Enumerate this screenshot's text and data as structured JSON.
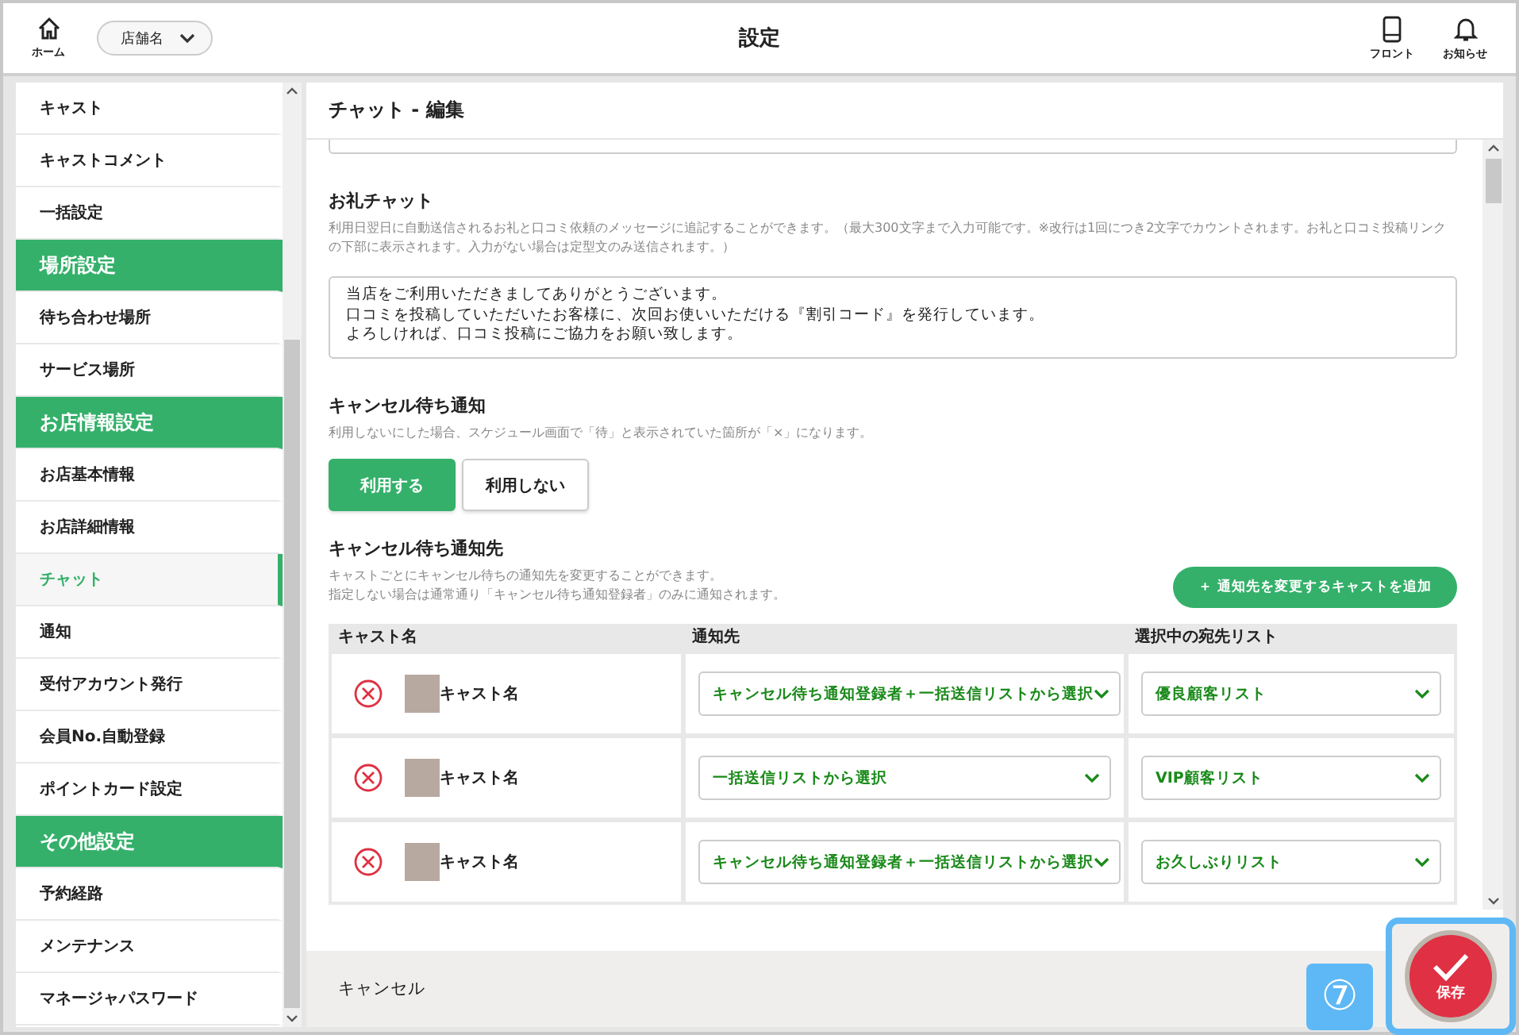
{
  "header": {
    "home_label": "ホーム",
    "store_select": "店舗名",
    "title": "設定",
    "actions": [
      {
        "kind": "phone",
        "label": "フロント"
      },
      {
        "kind": "bell",
        "label": "お知らせ"
      }
    ]
  },
  "sidebar": {
    "items": [
      {
        "kind": "item",
        "label": "キャスト",
        "selected": false
      },
      {
        "kind": "item",
        "label": "キャストコメント",
        "selected": false
      },
      {
        "kind": "item",
        "label": "一括設定",
        "selected": false
      },
      {
        "kind": "header",
        "label": "場所設定"
      },
      {
        "kind": "item",
        "label": "待ち合わせ場所",
        "selected": false
      },
      {
        "kind": "item",
        "label": "サービス場所",
        "selected": false
      },
      {
        "kind": "header",
        "label": "お店情報設定"
      },
      {
        "kind": "item",
        "label": "お店基本情報",
        "selected": false
      },
      {
        "kind": "item",
        "label": "お店詳細情報",
        "selected": false
      },
      {
        "kind": "item",
        "label": "チャット",
        "selected": true
      },
      {
        "kind": "item",
        "label": "通知",
        "selected": false
      },
      {
        "kind": "item",
        "label": "受付アカウント発行",
        "selected": false
      },
      {
        "kind": "item",
        "label": "会員No.自動登録",
        "selected": false
      },
      {
        "kind": "item",
        "label": "ポイントカード設定",
        "selected": false
      },
      {
        "kind": "header",
        "label": "その他設定"
      },
      {
        "kind": "item",
        "label": "予約経路",
        "selected": false
      },
      {
        "kind": "item",
        "label": "メンテナンス",
        "selected": false
      },
      {
        "kind": "item",
        "label": "マネージャパスワード",
        "selected": false
      }
    ]
  },
  "panel": {
    "title": "チャット - 編集",
    "thanks_chat": {
      "title": "お礼チャット",
      "description": "利用日翌日に自動送信されるお礼と口コミ依頼のメッセージに追記することができます。（最大300文字まで入力可能です。※改行は1回につき2文字でカウントされます。お礼と口コミ投稿リンクの下部に表示されます。入力がない場合は定型文のみ送信されます。）",
      "value_lines": [
        "当店をご利用いただきましてありがとうございます。",
        "口コミを投稿していただいたお客様に、次回お使いいただける『割引コード』を発行しています。",
        "よろしければ、口コミ投稿にご協力をお願い致します。"
      ]
    },
    "cancel_wait": {
      "title": "キャンセル待ち通知",
      "description": "利用しないにした場合、スケジュール画面で「待」と表示されていた箇所が「×」になります。",
      "options": [
        {
          "label": "利用する",
          "selected": true
        },
        {
          "label": "利用しない",
          "selected": false
        }
      ]
    },
    "cancel_wait_targets": {
      "title": "キャンセル待ち通知先",
      "description_lines": [
        "キャストごとにキャンセル待ちの通知先を変更することができます。",
        "指定しない場合は通常通り「キャンセル待ち通知登録者」のみに通知されます。"
      ],
      "add_button": "＋ 通知先を変更するキャストを追加",
      "table": {
        "columns": [
          "キャスト名",
          "通知先",
          "選択中の宛先リスト"
        ],
        "rows": [
          {
            "cast": "キャスト名",
            "target": "キャンセル待ち通知登録者＋一括送信リストから選択",
            "list": "優良顧客リスト"
          },
          {
            "cast": "キャスト名",
            "target": "一括送信リストから選択",
            "list": "VIP顧客リスト"
          },
          {
            "cast": "キャスト名",
            "target": "キャンセル待ち通知登録者＋一括送信リストから選択",
            "list": "お久しぶりリスト"
          }
        ]
      }
    }
  },
  "footer": {
    "cancel": "キャンセル",
    "step_marker": "⑦",
    "save": "保存"
  }
}
